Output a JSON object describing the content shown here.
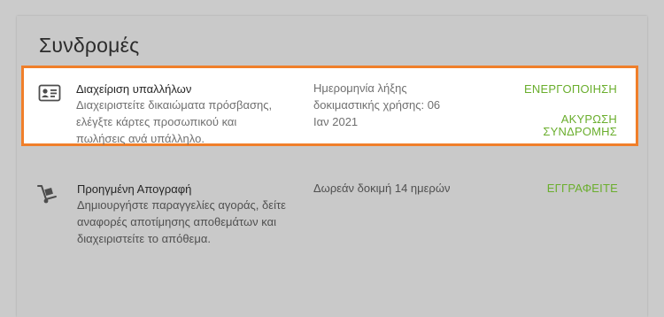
{
  "page": {
    "title": "Συνδρομές"
  },
  "subscriptions": [
    {
      "icon": "id-card-icon",
      "name": "Διαχείριση υπαλλήλων",
      "description": "Διαχειριστείτε δικαιώματα πρόσβασης, ελέγξτε κάρτες προσωπικού και πωλήσεις ανά υπάλληλο.",
      "status": "Ημερομηνία λήξης δοκιμαστικής χρήσης: 06 Ιαν 2021",
      "actions": [
        "ΕΝΕΡΓΟΠΟΙΗΣΗ",
        "ΑΚΥΡΩΣΗ ΣΥΝΔΡΟΜΗΣ"
      ],
      "highlighted": true
    },
    {
      "icon": "hand-truck-icon",
      "name": "Προηγμένη Απογραφή",
      "description": "Δημιουργήστε παραγγελίες αγοράς, δείτε αναφορές αποτίμησης αποθεμάτων και διαχειριστείτε το απόθεμα.",
      "status": "Δωρεάν δοκιμή 14 ημερών",
      "actions": [
        "ΕΓΓΡΑΦΕΙΤΕ"
      ],
      "highlighted": false
    }
  ],
  "colors": {
    "accent": "#6aae2d",
    "highlight_border": "#f07f2a",
    "background": "#cbcbcb"
  }
}
